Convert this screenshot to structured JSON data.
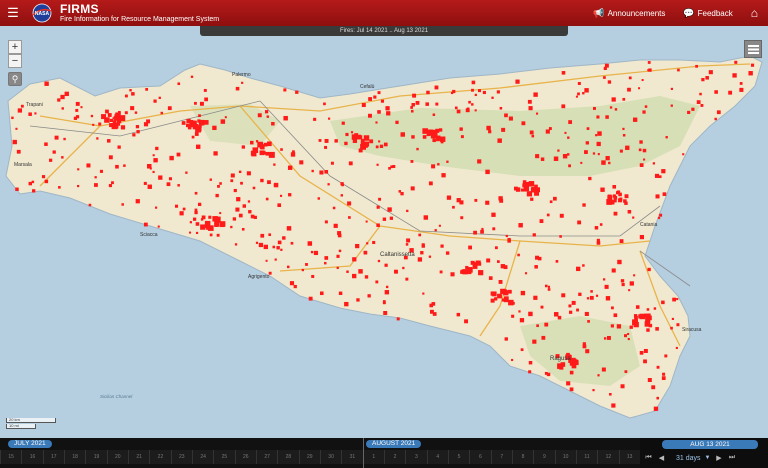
{
  "header": {
    "title": "FIRMS",
    "subtitle": "Fire Information for Resource Management System",
    "logo_text": "NASA",
    "announcements_label": "Announcements",
    "feedback_label": "Feedback"
  },
  "range_label": "Fires: Jul 14 2021 .. Aug 13 2021",
  "map": {
    "sea_color": "#b5cfe0",
    "land_color": "#f1e9cf",
    "hill_color": "#cfdcae",
    "fire_color": "#ff1a1a",
    "road_color": "#e8b34a",
    "cities": [
      "Palermo",
      "Trapani",
      "Caltanissetta",
      "Agrigento",
      "Ragusa",
      "Siracusa",
      "Marsala",
      "Sciacca",
      "Cefalù",
      "Catania"
    ],
    "sea_label": "Sicilian Channel",
    "scale": [
      "20 km",
      "10 mi"
    ]
  },
  "controls": {
    "zoom_in": "+",
    "zoom_out": "−",
    "locate": "⚲"
  },
  "timeline": {
    "month1": "JULY 2021",
    "month2": "AUGUST 2021",
    "end_date": "AUG 13 2021",
    "period": "31 days",
    "days": [
      "15",
      "16",
      "17",
      "18",
      "19",
      "20",
      "21",
      "22",
      "23",
      "24",
      "25",
      "26",
      "27",
      "28",
      "29",
      "30",
      "31",
      "1",
      "2",
      "3",
      "4",
      "5",
      "6",
      "7",
      "8",
      "9",
      "10",
      "11",
      "12",
      "13"
    ]
  }
}
